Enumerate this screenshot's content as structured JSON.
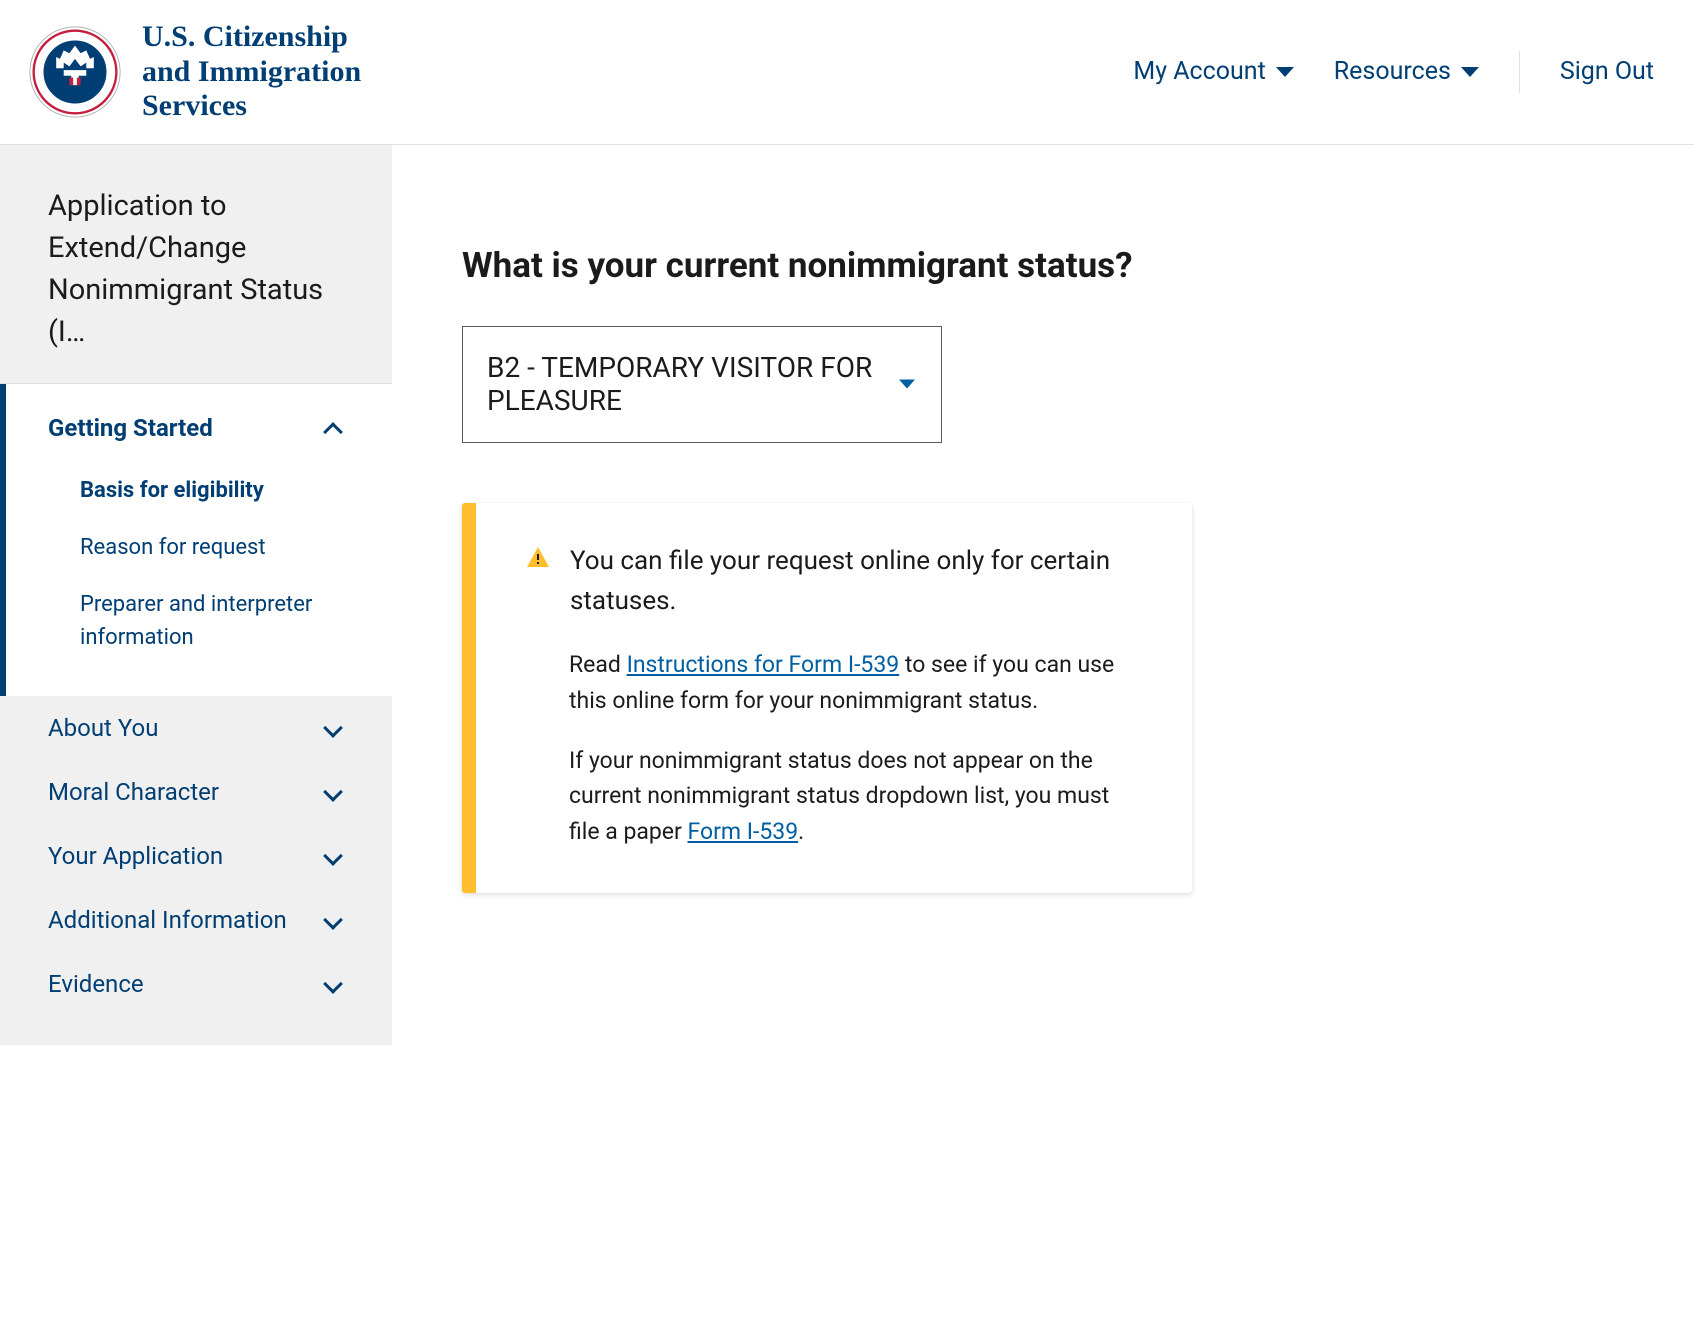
{
  "header": {
    "brand_line1": "U.S. Citizenship",
    "brand_line2": "and Immigration",
    "brand_line3": "Services",
    "nav": {
      "my_account": "My Account",
      "resources": "Resources",
      "sign_out": "Sign Out"
    }
  },
  "sidebar": {
    "title": "Application to Extend/Change Nonimmigrant Status (I…",
    "sections": [
      {
        "label": "Getting Started",
        "expanded": true,
        "items": [
          {
            "label": "Basis for eligibility",
            "active": true
          },
          {
            "label": "Reason for request",
            "active": false
          },
          {
            "label": "Preparer and interpreter information",
            "active": false
          }
        ]
      },
      {
        "label": "About You",
        "expanded": false
      },
      {
        "label": "Moral Character",
        "expanded": false
      },
      {
        "label": "Your Application",
        "expanded": false
      },
      {
        "label": "Additional Information",
        "expanded": false
      },
      {
        "label": "Evidence",
        "expanded": false
      }
    ]
  },
  "main": {
    "question": "What is your current nonimmigrant status?",
    "select_value": "B2 - TEMPORARY VISITOR FOR PLEASURE",
    "alert": {
      "title": "You can file your request online only for certain statuses.",
      "p1_a": "Read ",
      "p1_link": "Instructions for Form I-539",
      "p1_b": " to see if you can use this online form for your nonimmigrant status.",
      "p2_a": "If your nonimmigrant status does not appear on the current nonimmigrant status dropdown list, you must file a paper ",
      "p2_link": "Form I-539",
      "p2_b": "."
    }
  }
}
